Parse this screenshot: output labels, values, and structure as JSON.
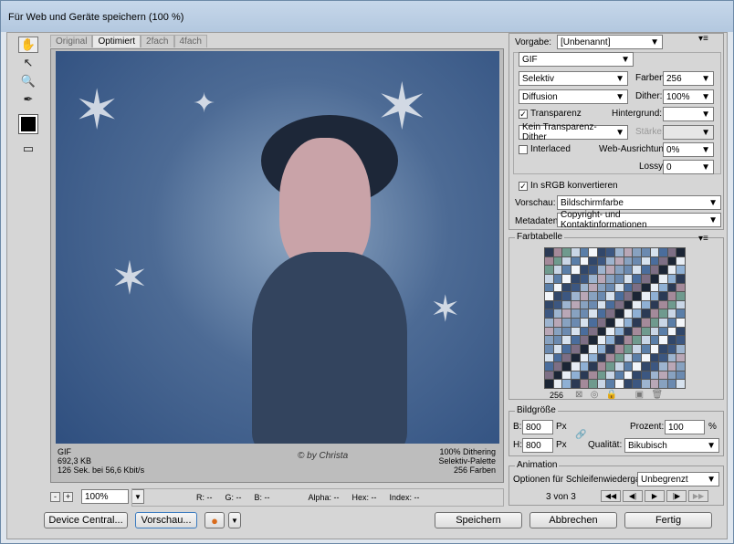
{
  "window": {
    "title": "Für Web und Geräte speichern (100 %)"
  },
  "tabs": [
    "Original",
    "Optimiert",
    "2fach",
    "4fach"
  ],
  "image_info": {
    "format": "GIF",
    "size": "692,3 KB",
    "time": "126 Sek. bei 56,6 Kbit/s",
    "dither": "100% Dithering",
    "palette": "Selektiv-Palette",
    "colors": "256 Farben",
    "signature": "© by Christa"
  },
  "zoom": {
    "value": "100%",
    "minus": "-",
    "plus": "+"
  },
  "readout": {
    "r": "R: --",
    "g": "G: --",
    "b": "B: --",
    "alpha": "Alpha: --",
    "hex": "Hex: --",
    "index": "Index: --"
  },
  "buttons": {
    "device_central": "Device Central...",
    "preview": "Vorschau...",
    "save": "Speichern",
    "cancel": "Abbrechen",
    "done": "Fertig"
  },
  "settings": {
    "preset_label": "Vorgabe:",
    "preset_value": "[Unbenannt]",
    "format": "GIF",
    "reduction": "Selektiv",
    "colors_label": "Farben:",
    "colors_value": "256",
    "dither_algo": "Diffusion",
    "dither_label": "Dither:",
    "dither_value": "100%",
    "transparency_label": "Transparenz",
    "matte_label": "Hintergrund:",
    "transparency_dither": "Kein Transparenz-Dither",
    "amount_label": "Stärke:",
    "interlaced_label": "Interlaced",
    "web_snap_label": "Web-Ausrichtung:",
    "web_snap_value": "0%",
    "lossy_label": "Lossy:",
    "lossy_value": "0",
    "srgb_label": "In sRGB konvertieren",
    "preview_label": "Vorschau:",
    "preview_value": "Bildschirmfarbe",
    "metadata_label": "Metadaten:",
    "metadata_value": "Copyright- und Kontaktinformationen"
  },
  "color_table": {
    "title": "Farbtabelle",
    "count": "256"
  },
  "image_size": {
    "title": "Bildgröße",
    "width_label": "B:",
    "width_value": "800",
    "height_label": "H:",
    "height_value": "800",
    "unit": "Px",
    "percent_label": "Prozent:",
    "percent_value": "100",
    "percent_unit": "%",
    "quality_label": "Qualität:",
    "quality_value": "Bikubisch"
  },
  "animation": {
    "title": "Animation",
    "loop_label": "Optionen für Schleifenwiedergabe:",
    "loop_value": "Unbegrenzt",
    "frame": "3 von 3"
  },
  "icons": [
    "hand-tool-icon",
    "slice-select-icon",
    "zoom-icon",
    "eyedropper-icon",
    "color-swatch-icon",
    "toggle-slices-icon",
    "panel-menu-icon",
    "firefox-icon",
    "link-chain-icon"
  ]
}
